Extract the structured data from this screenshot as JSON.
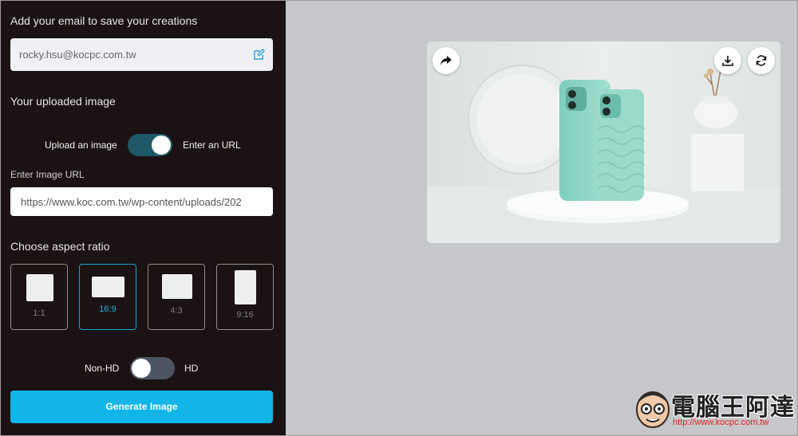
{
  "email_section": {
    "label": "Add your email to save your creations",
    "email_value": "rocky.hsu@kocpc.com.tw"
  },
  "upload_section": {
    "title": "Your uploaded image",
    "toggle_left": "Upload an image",
    "toggle_right": "Enter an URL",
    "toggle_state": "url",
    "url_label": "Enter Image URL",
    "url_value": "https://www.koc.com.tw/wp-content/uploads/202"
  },
  "aspect_section": {
    "title": "Choose aspect ratio",
    "options": [
      "1:1",
      "16:9",
      "4:3",
      "9:16"
    ],
    "selected": "16:9"
  },
  "hd_toggle": {
    "left": "Non-HD",
    "right": "HD",
    "state": "non-hd"
  },
  "generate_button": "Generate Image",
  "preview": {
    "icons": [
      "share-icon",
      "download-icon",
      "refresh-icon"
    ]
  },
  "watermark": {
    "title": "電腦王阿達",
    "url": "http://www.kocpc.com.tw"
  },
  "colors": {
    "panel_bg": "#1b1313",
    "accent": "#12b5e8",
    "selected_border": "#1ba0d3",
    "toggle_on": "#1f5866",
    "toggle_off": "#4d5461",
    "canvas_bg": "#c6c7cb"
  }
}
